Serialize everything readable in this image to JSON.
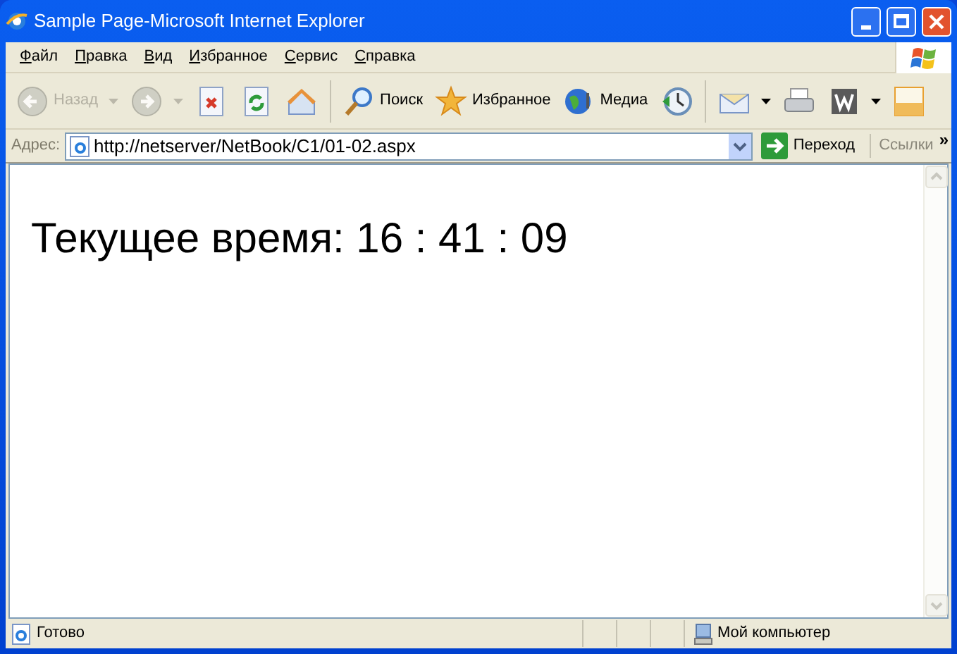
{
  "window": {
    "title": "Sample Page-Microsoft Internet Explorer"
  },
  "menu": [
    {
      "label": "Файл"
    },
    {
      "label": "Правка"
    },
    {
      "label": "Вид"
    },
    {
      "label": "Избранное"
    },
    {
      "label": "Сервис"
    },
    {
      "label": "Справка"
    }
  ],
  "toolbar": [
    {
      "kind": "back",
      "label": "Назад",
      "disabled": true,
      "dropdown": true
    },
    {
      "kind": "forward",
      "disabled": true,
      "dropdown": true
    },
    {
      "kind": "stop",
      "disabled": false
    },
    {
      "kind": "refresh",
      "disabled": false
    },
    {
      "kind": "home",
      "disabled": false
    },
    {
      "kind": "sep"
    },
    {
      "kind": "search",
      "label": "Поиск",
      "disabled": false
    },
    {
      "kind": "favorites",
      "label": "Избранное",
      "disabled": false
    },
    {
      "kind": "media",
      "label": "Медиа",
      "disabled": false
    },
    {
      "kind": "history",
      "disabled": false
    },
    {
      "kind": "sep"
    },
    {
      "kind": "mail",
      "disabled": false,
      "dropdown": true
    },
    {
      "kind": "print",
      "disabled": false
    },
    {
      "kind": "edit",
      "disabled": false,
      "dropdown": true
    },
    {
      "kind": "note",
      "disabled": false
    }
  ],
  "address_bar": {
    "label": "Адрес:",
    "value": "http://netserver/NetBook/C1/01-02.aspx",
    "go_button": "Переход",
    "links": "Ссылки",
    "more": "»"
  },
  "content": {
    "text": "Текущее время: 16 : 41 : 09"
  },
  "status_bar": {
    "text": "Готово",
    "zone": "Мой компьютер"
  }
}
